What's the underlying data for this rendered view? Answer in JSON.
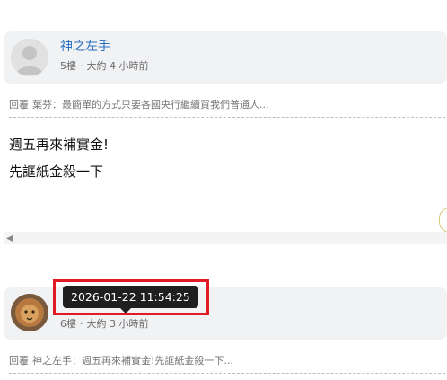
{
  "posts": [
    {
      "author": "神之左手",
      "floor": "5樓",
      "separator": "·",
      "time_ago": "大約 4 小時前",
      "reply_prefix": "回覆",
      "reply_target": "葉芬：最簡單的方式只要各國央行繼續買我們普通人...",
      "content": [
        "週五再來補實金!",
        "先誆紙金殺一下"
      ]
    },
    {
      "author": "",
      "floor": "6樓",
      "separator": "·",
      "time_ago": "大約 3 小時前",
      "reply_prefix": "回覆",
      "reply_target": "神之左手：週五再來補實金!先誆紙金殺一下..."
    }
  ],
  "tooltip": {
    "text": "2026-01-22 11:54:25"
  },
  "colors": {
    "highlight": "#e01b24",
    "author": "#2a6ebd",
    "tooltip_bg": "#1f1f1f"
  }
}
